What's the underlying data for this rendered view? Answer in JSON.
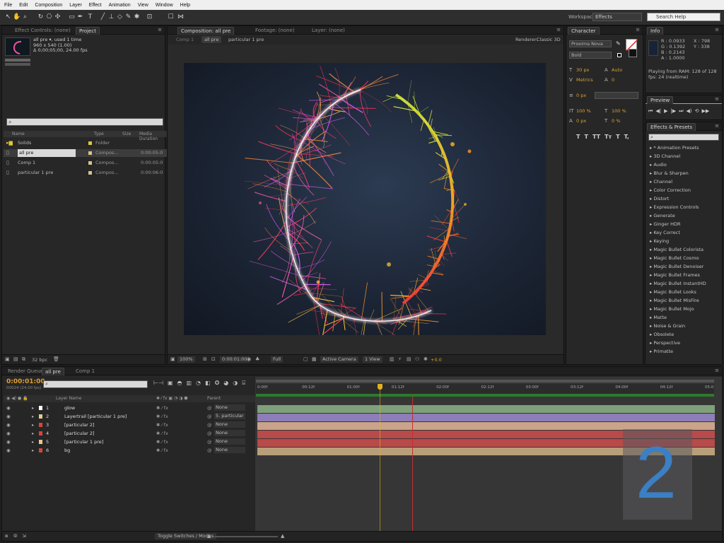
{
  "menu": [
    "File",
    "Edit",
    "Composition",
    "Layer",
    "Effect",
    "Animation",
    "View",
    "Window",
    "Help"
  ],
  "toolbar": {
    "workspace_label": "Workspace:",
    "workspace_value": "Effects",
    "search_placeholder": "Search Help"
  },
  "project_panel": {
    "tabs": [
      "Effect Controls: (none)",
      "Project"
    ],
    "comp_name": "all pre ▾, used 1 time",
    "comp_size": "960 x 540 (1.00)",
    "comp_duration": "Δ 0;00;05;00, 24.00 fps",
    "columns": [
      "Name",
      "Type",
      "Size",
      "Media Duration"
    ],
    "items": [
      {
        "name": "Solids",
        "type": "Folder",
        "duration": "",
        "color": "#e3c43a"
      },
      {
        "name": "all pre",
        "type": "Compos...",
        "duration": "0:00:05:0",
        "color": "#d8c38a"
      },
      {
        "name": "Comp 1",
        "type": "Compos...",
        "duration": "0:00:05:0",
        "color": "#d8c38a"
      },
      {
        "name": "particular 1 pre",
        "type": "Compos...",
        "duration": "0:00:06:0",
        "color": "#d8c38a"
      }
    ],
    "bpc": "32 bpc"
  },
  "composition_panel": {
    "tabs": [
      "Composition: all pre",
      "Footage: (none)",
      "Layer: (none)"
    ],
    "breadcrumbs": [
      "Comp 1",
      "all pre",
      "particular 1 pre"
    ],
    "renderer": "Renderer:",
    "renderer_value": "Classic 3D",
    "zoom": "100%",
    "timecode": "0:00:01:00",
    "resolution": "Full",
    "camera": "Active Camera",
    "views": "1 View",
    "offset": "+0.0"
  },
  "character_panel": {
    "tab": "Character",
    "font": "Proxima Nova",
    "style": "Bold",
    "size": "30 px",
    "leading": "Auto",
    "kerning": "Metrics",
    "tracking": "0",
    "stroke": "0 px",
    "v_scale": "100 %",
    "h_scale": "100 %",
    "baseline": "0 px",
    "tsume": "0 %",
    "styles": [
      "T",
      "T",
      "TT",
      "Tт",
      "T",
      "T,"
    ]
  },
  "info_panel": {
    "tab": "Info",
    "r": "R : 0.0933",
    "g": "G : 0.1392",
    "b": "B : 0.2143",
    "a": "A : 1.0000",
    "x": "X : 798",
    "y": "Y : 338",
    "playing": "Playing from RAM: 128 of 128",
    "fps": "fps: 24 (realtime)"
  },
  "preview_panel": {
    "tab": "Preview"
  },
  "effects_panel": {
    "tab": "Effects & Presets",
    "items": [
      "* Animation Presets",
      "3D Channel",
      "Audio",
      "Blur & Sharpen",
      "Channel",
      "Color Correction",
      "Distort",
      "Expression Controls",
      "Generate",
      "Ginger HDR",
      "Key Correct",
      "Keying",
      "Magic Bullet Colorista",
      "Magic Bullet Cosmo",
      "Magic Bullet Denoiser",
      "Magic Bullet Frames",
      "Magic Bullet InstantHD",
      "Magic Bullet Looks",
      "Magic Bullet MisFire",
      "Magic Bullet Mojo",
      "Matte",
      "Noise & Grain",
      "Obsolete",
      "Perspective",
      "Primatte"
    ]
  },
  "timeline": {
    "tabs": [
      "Render Queue",
      "all pre",
      "Comp 1"
    ],
    "timecode": "0:00:01:00",
    "timecode_sub": "00024 (24.00 fps)",
    "columns": [
      "Layer Name",
      "Parent"
    ],
    "ruler": [
      "0:00f",
      "00:12f",
      "01:00f",
      "01:12f",
      "02:00f",
      "02:12f",
      "03:00f",
      "03:12f",
      "04:00f",
      "04:12f",
      "05:0"
    ],
    "playhead_fraction": 0.267,
    "work_area_end_fraction": 1.0,
    "layers": [
      {
        "num": "1",
        "name": "glow",
        "parent": "None",
        "color": "#ffffff",
        "bar": "#7fa07a"
      },
      {
        "num": "2",
        "name": "Layertrail [particular 1 pre]",
        "parent": "5. particular",
        "color": "#e6c98a",
        "bar": "#8d7db8"
      },
      {
        "num": "3",
        "name": "[particular 2]",
        "parent": "None",
        "color": "#d7443c",
        "bar": "#c9a48a"
      },
      {
        "num": "4",
        "name": "[particular 2]",
        "parent": "None",
        "color": "#d7443c",
        "bar": "#b84a4a"
      },
      {
        "num": "5",
        "name": "[particular 1 pre]",
        "parent": "None",
        "color": "#e6c98a",
        "bar": "#b84a4a"
      },
      {
        "num": "6",
        "name": "bg",
        "parent": "None",
        "color": "#d7443c",
        "bar": "#b89f7a"
      }
    ],
    "toggle_label": "Toggle Switches / Modes"
  },
  "overlay_number": "2"
}
